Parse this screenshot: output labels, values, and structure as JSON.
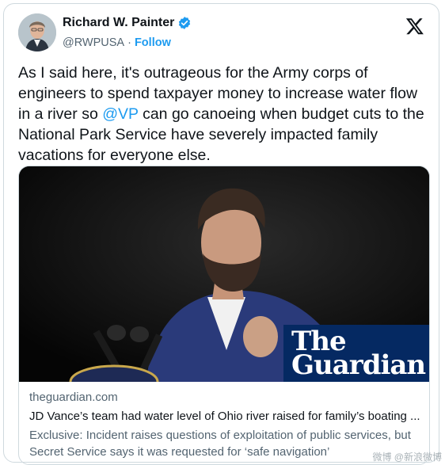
{
  "author": {
    "name": "Richard W. Painter",
    "handle": "@RWPUSA",
    "separator": "·",
    "follow_label": "Follow",
    "verified": true
  },
  "icons": {
    "verified": "verified-badge-icon",
    "x_logo": "x-logo-icon"
  },
  "tweet": {
    "text_before": "As I said here, it's outrageous for the Army corps of engineers to spend taxpayer money to increase water flow in a river so ",
    "mention": "@VP",
    "text_after": " can go canoeing when budget cuts to the National Park Service have severely impacted family vacations for everyone else."
  },
  "link_card": {
    "badge_line1": "The",
    "badge_line2": "Guardian",
    "domain": "theguardian.com",
    "title": "JD Vance’s team had water level of Ohio river raised for family’s boating ...",
    "description": "Exclusive: Incident raises questions of exploitation of public services, but Secret Service says it was requested for ‘safe navigation’"
  },
  "watermark": "微博 @新浪微博",
  "colors": {
    "accent": "#1d9bf0",
    "guardian_blue": "#052962",
    "muted_text": "#536471",
    "border": "#cfd9de"
  }
}
